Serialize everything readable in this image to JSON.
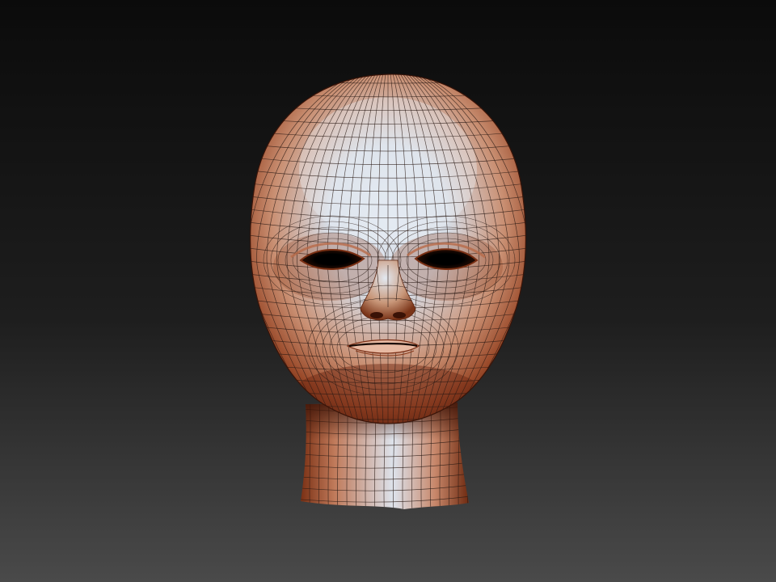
{
  "viewport": {
    "background_top": "#0b0b0b",
    "background_bottom": "#4a4a4a"
  },
  "model": {
    "type": "head-bust",
    "render_mode": "polyframe-wireframe-shaded",
    "material_colors": {
      "highlight": "#dfe6f0",
      "midtone": "#c98f72",
      "rim": "#9a4a2a",
      "shadow": "#5c2410"
    },
    "wire_color": "#2a1a14"
  }
}
